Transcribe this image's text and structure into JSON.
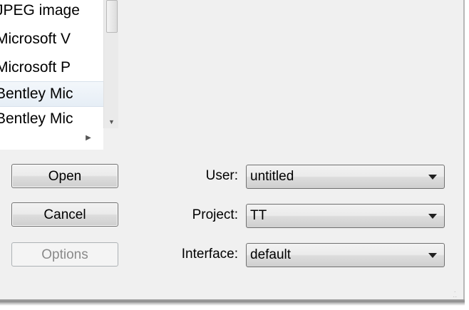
{
  "file_types": {
    "items": [
      {
        "label": "JPEG image"
      },
      {
        "label": "Microsoft V"
      },
      {
        "label": "Microsoft P"
      },
      {
        "label": "Bentley Mic"
      },
      {
        "label": "Bentley Mic"
      }
    ]
  },
  "buttons": {
    "open": "Open",
    "cancel": "Cancel",
    "options": "Options"
  },
  "fields": {
    "user": {
      "label": "User:",
      "value": "untitled"
    },
    "project": {
      "label": "Project:",
      "value": "TT"
    },
    "interface": {
      "label": "Interface:",
      "value": "default"
    }
  },
  "icons": {
    "scroll_down": "chevron-down-icon",
    "scroll_right": "chevron-right-icon",
    "combo_arrow": "caret-down-icon",
    "resize_grip": "resize-grip-icon"
  }
}
